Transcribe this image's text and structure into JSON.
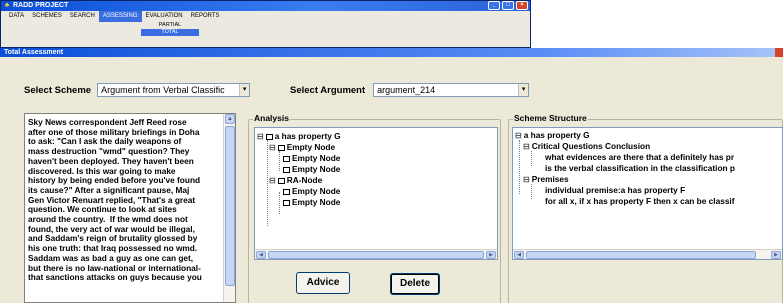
{
  "app": {
    "title": "RADD PROJECT",
    "menu": [
      "DATA",
      "SCHEMES",
      "SEARCH",
      "ASSESSING",
      "EVALUATION",
      "REPORTS"
    ],
    "active_menu_index": 3,
    "submenu": [
      "PARTIAL",
      "TOTAL"
    ],
    "active_submenu_index": 1
  },
  "window": {
    "title": "Total Assessment"
  },
  "scheme": {
    "label": "Select Scheme",
    "value": "Argument from Verbal Classific"
  },
  "argument": {
    "label": "Select Argument",
    "value": "argument_214"
  },
  "text": {
    "content": "Sky News correspondent Jeff Reed rose\nafter one of those military briefings in Doha\nto ask: \"Can I ask the daily weapons of\nmass destruction \"wmd\" question? They\nhaven't been deployed. They haven't been\ndiscovered. Is this war going to make\nhistory by being ended before you've found\nits cause?\" After a significant pause, Maj\nGen Victor Renuart replied, \"That's a great\nquestion. We continue to look at sites\naround the country.  If the wmd does not\nfound, the very act of war would be illegal,\nand Saddam's reign of brutality glossed by\nhis one truth: that Iraq possessed no wmd.\nSaddam was as bad a guy as one can get,\nbut there is no law-national or international-\nthat sanctions attacks on guys because you"
  },
  "analysis": {
    "label": "Analysis",
    "nodes": [
      {
        "label": "a has property G"
      },
      {
        "label": "Empty Node"
      },
      {
        "label": "Empty Node"
      },
      {
        "label": "Empty Node"
      },
      {
        "label": "RA-Node"
      },
      {
        "label": "Empty Node"
      },
      {
        "label": "Empty Node"
      }
    ]
  },
  "structure": {
    "label": "Scheme Structure",
    "nodes": [
      {
        "label": "a has property G"
      },
      {
        "label": "Critical Questions Conclusion"
      },
      {
        "label": "what evidences are there that a definitely has pr"
      },
      {
        "label": "is the verbal classification in the classification p"
      },
      {
        "label": "Premises"
      },
      {
        "label": "individual premise:a has property F"
      },
      {
        "label": "for all x, if x has property F then x can be classif"
      }
    ]
  },
  "buttons": {
    "advice": "Advice",
    "delete": "Delete"
  }
}
